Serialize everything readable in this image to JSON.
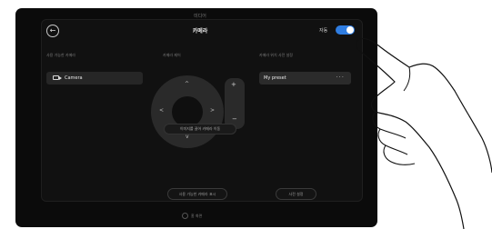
{
  "device": {
    "top_label": "미디어"
  },
  "header": {
    "back_icon": "back-arrow-icon",
    "title": "카메라",
    "autofocus_label": "자동",
    "autofocus_on": true
  },
  "columns": {
    "left_label": "사용 가능한 카메라",
    "center_label": "카메라 제어",
    "right_label": "카메라 위치 사전 설정"
  },
  "camera_button": {
    "label": "Camera",
    "icon": "camera-icon"
  },
  "preset_button": {
    "label": "My preset",
    "more": "···"
  },
  "control": {
    "up": "^",
    "down": "v",
    "left": "<",
    "right": ">",
    "zoom_in": "+",
    "zoom_out": "−",
    "drag_hint": "이미지를 끌어 카메라 이동"
  },
  "footer": {
    "left_button": "사용 가능한 카메라 표시",
    "right_button": "사전 설정",
    "home_label": "홈 화면"
  },
  "colors": {
    "accent": "#2f7de1",
    "background": "#0b0b0b"
  }
}
